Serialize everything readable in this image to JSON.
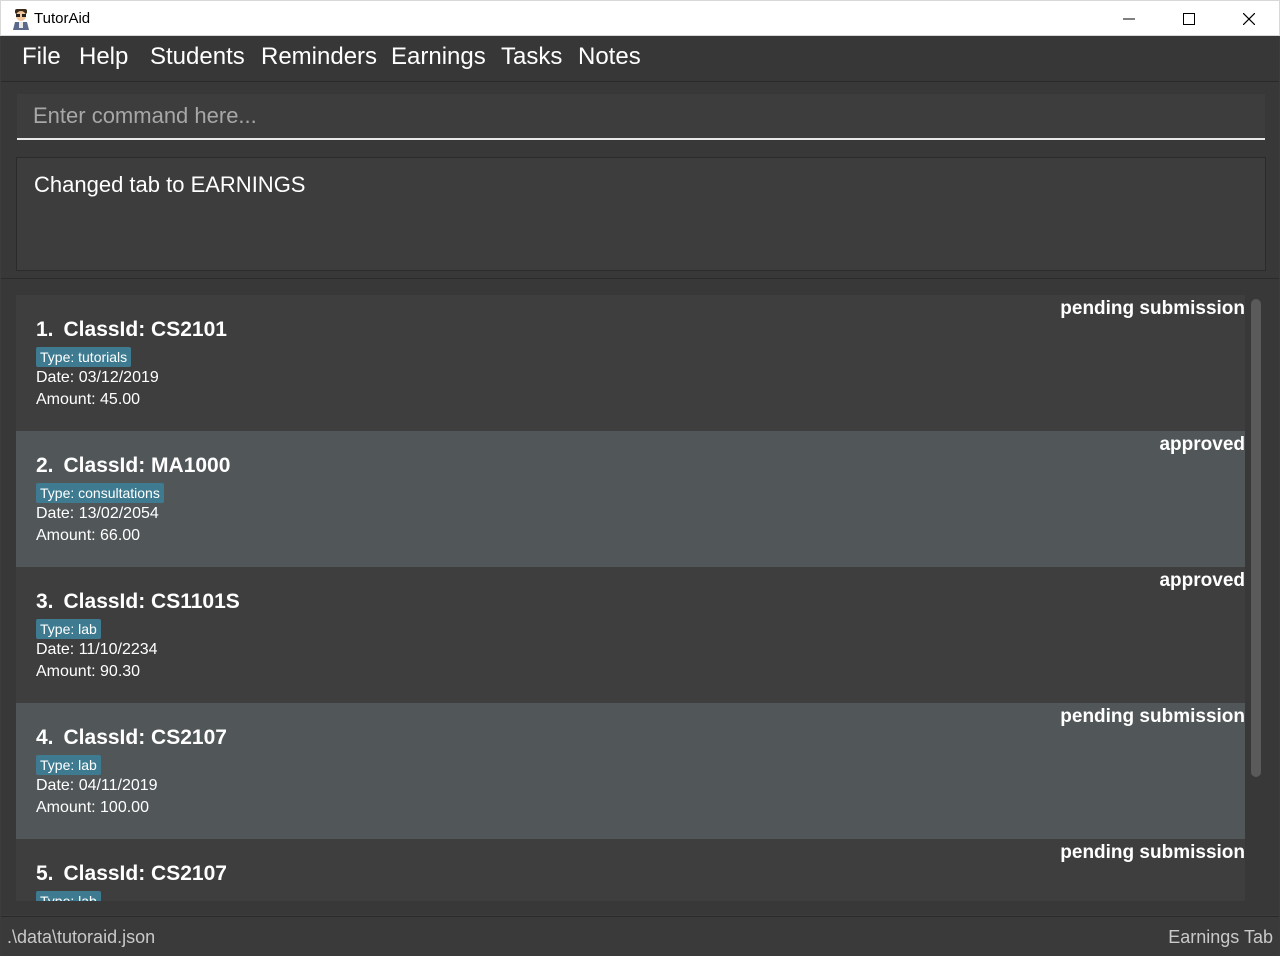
{
  "window": {
    "title": "TutorAid",
    "icon": "tutor-avatar-icon"
  },
  "menu": {
    "items": [
      "File",
      "Help",
      "Students",
      "Reminders",
      "Earnings",
      "Tasks",
      "Notes"
    ]
  },
  "command": {
    "placeholder": "Enter command here...",
    "value": ""
  },
  "result": {
    "message": "Changed tab to EARNINGS"
  },
  "earnings": [
    {
      "index": "1.",
      "class_id": "ClassId: CS2101",
      "type": "Type: tutorials",
      "date": "Date: 03/12/2019",
      "amount": "Amount: 45.00",
      "status": "pending submission"
    },
    {
      "index": "2.",
      "class_id": "ClassId: MA1000",
      "type": "Type: consultations",
      "date": "Date: 13/02/2054",
      "amount": "Amount: 66.00",
      "status": "approved"
    },
    {
      "index": "3.",
      "class_id": "ClassId: CS1101S",
      "type": "Type: lab",
      "date": "Date: 11/10/2234",
      "amount": "Amount: 90.30",
      "status": "approved"
    },
    {
      "index": "4.",
      "class_id": "ClassId: CS2107",
      "type": "Type: lab",
      "date": "Date: 04/11/2019",
      "amount": "Amount: 100.00",
      "status": "pending submission"
    },
    {
      "index": "5.",
      "class_id": "ClassId: CS2107",
      "type": "Type: lab",
      "date": "",
      "amount": "",
      "status": "pending submission"
    }
  ],
  "statusbar": {
    "path": ".\\data\\tutoraid.json",
    "tab": "Earnings Tab"
  },
  "colors": {
    "background": "#3c3c3c",
    "card_odd": "#3e3e3e",
    "card_even": "#515658",
    "tag": "#3e7b91"
  }
}
